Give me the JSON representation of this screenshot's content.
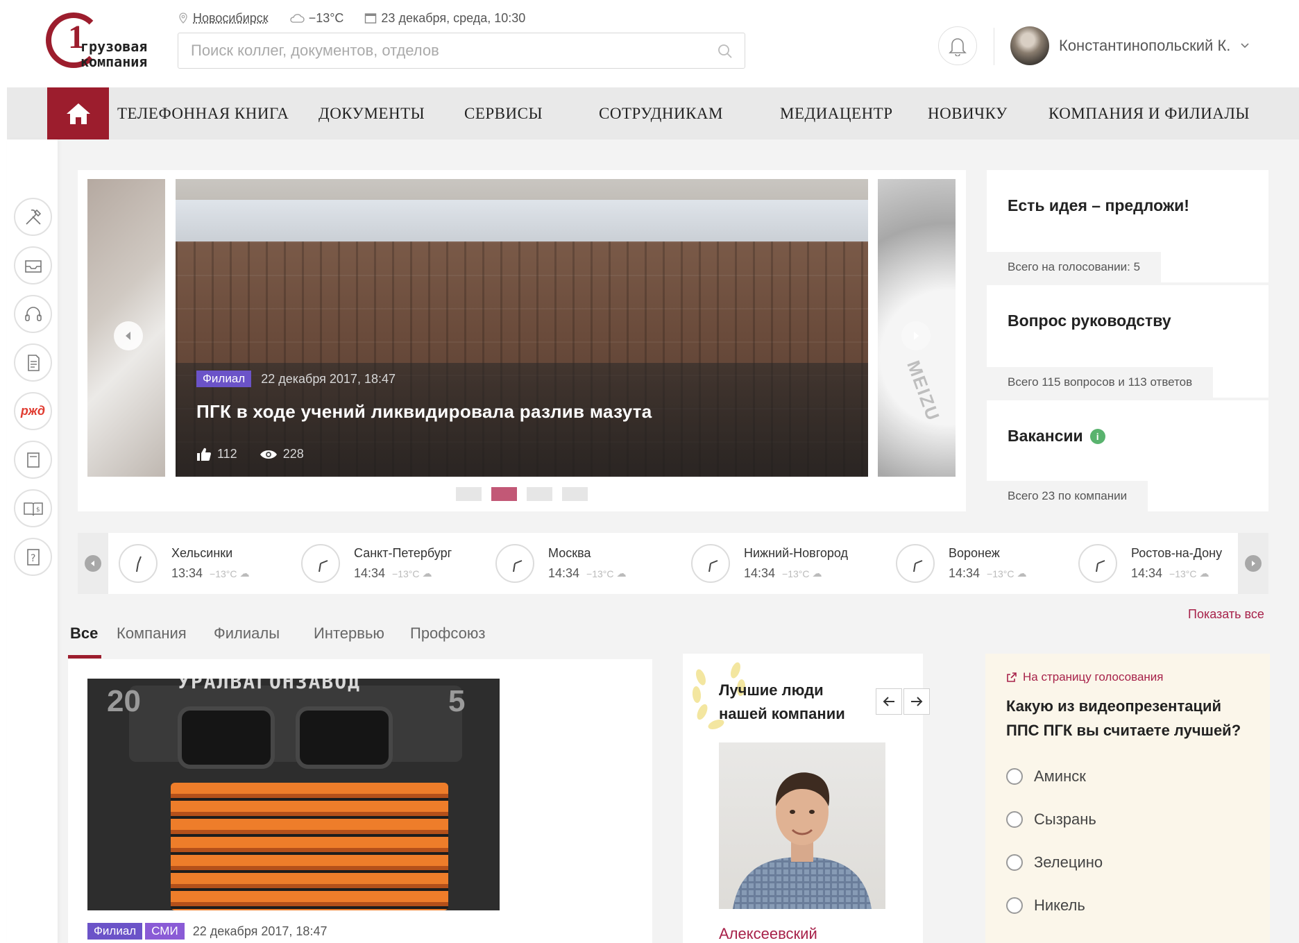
{
  "header": {
    "logo_text_line1": "грузовая",
    "logo_text_line2": "компания",
    "logo_digit": "1",
    "city": "Новосибирск",
    "temperature": "−13°C",
    "datetime": "23 декабря, среда, 10:30",
    "search_placeholder": "Поиск коллег, документов, отделов",
    "user_name": "Константинопольский К."
  },
  "nav": {
    "items": [
      "ТЕЛЕФОННАЯ КНИГА",
      "ДОКУМЕНТЫ",
      "СЕРВИСЫ",
      "СОТРУДНИКАМ",
      "МЕДИАЦЕНТР",
      "НОВИЧКУ",
      "КОМПАНИЯ И ФИЛИАЛЫ"
    ]
  },
  "sidebar": {
    "icons": [
      "tools-icon",
      "inbox-icon",
      "headset-icon",
      "document-edit-icon",
      "rzd-logo-icon",
      "book-icon",
      "reader-money-icon",
      "help-icon"
    ],
    "rzd_text": "ржд"
  },
  "slider": {
    "badge": "Филиал",
    "date": "22 декабря 2017, 18:47",
    "title": "ПГК в ходе учений ликвидировала разлив мазута",
    "likes": "112",
    "views": "228",
    "next_watermark": "MEIZU",
    "active_dot": 1,
    "dots": 4
  },
  "right_cards": [
    {
      "title": "Есть идея – предложи!",
      "footer": "Всего на голосовании: 5"
    },
    {
      "title": "Вопрос руководству",
      "footer": "Всего 115 вопросов и 113 ответов"
    },
    {
      "title": "Вакансии",
      "footer": "Всего 23 по компании"
    }
  ],
  "clocks": [
    {
      "city": "Хельсинки",
      "time": "13:34",
      "temp": "−13°C"
    },
    {
      "city": "Санкт-Петербург",
      "time": "14:34",
      "temp": "−13°C"
    },
    {
      "city": "Москва",
      "time": "14:34",
      "temp": "−13°C"
    },
    {
      "city": "Нижний-Новгород",
      "time": "14:34",
      "temp": "−13°C"
    },
    {
      "city": "Воронеж",
      "time": "14:34",
      "temp": "−13°C"
    },
    {
      "city": "Ростов-на-Дону",
      "time": "14:34",
      "temp": "−13°C"
    }
  ],
  "show_all": "Показать все",
  "tabs": [
    "Все",
    "Компания",
    "Филиалы",
    "Интервью",
    "Профсоюз"
  ],
  "news": {
    "image_caption": "УРАЛВАГОНЗАВОД",
    "image_number_left": "20",
    "image_number_right": "5",
    "badge1": "Филиал",
    "badge2": "СМИ",
    "date": "22 декабря 2017, 18:47"
  },
  "best_people": {
    "title": "Лучшие люди нашей компании",
    "name": "Алексеевский"
  },
  "poll": {
    "link": "На страницу голосования",
    "question": "Какую из видеопрезентаций ППС ПГК вы считаете лучшей?",
    "options": [
      "Аминск",
      "Сызрань",
      "Зелецино",
      "Никель"
    ]
  },
  "colors": {
    "brand": "#9c1d2d",
    "badge_purple": "#6b53c8",
    "accent_link": "#a7224a",
    "active_dot": "#c25876"
  }
}
